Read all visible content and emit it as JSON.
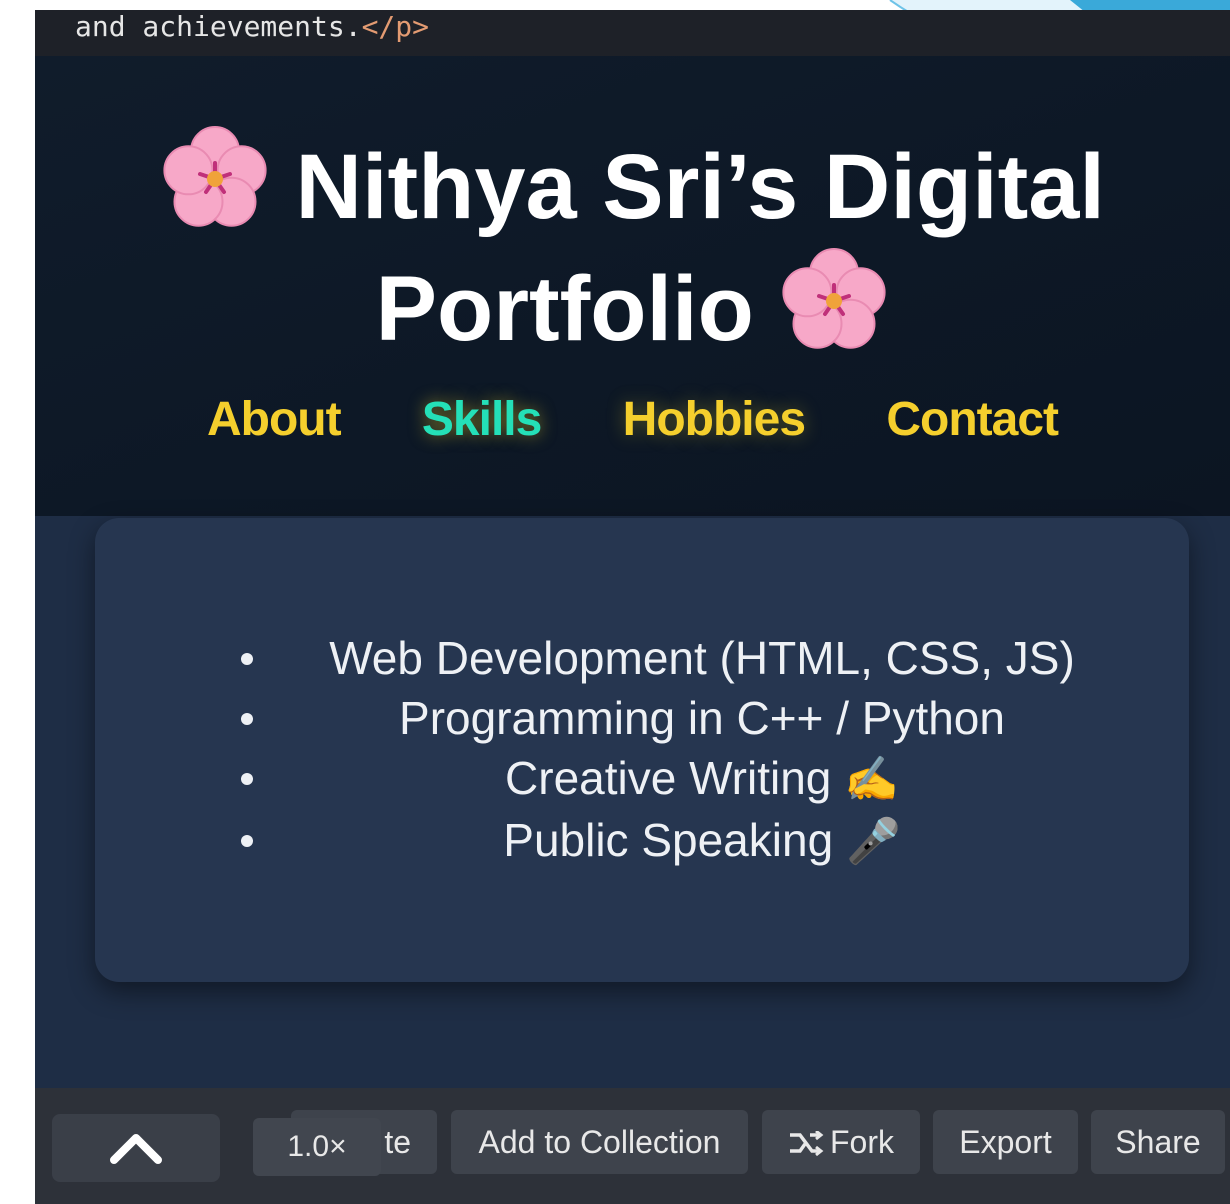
{
  "code_line": {
    "text": "and achievements.",
    "closing_tag": "</p>"
  },
  "page": {
    "title_line1": "Nithya Sri’s Digital",
    "title_line2": "Portfolio",
    "flower_icon": "cherry-blossom-icon",
    "nav": [
      {
        "label": "About",
        "active": false
      },
      {
        "label": "Skills",
        "active": true
      },
      {
        "label": "Hobbies",
        "active": false
      },
      {
        "label": "Contact",
        "active": false
      }
    ],
    "skills": [
      {
        "text": "Web Development (HTML, CSS, JS)",
        "emoji": ""
      },
      {
        "text": "Programming in C++ / Python",
        "emoji": ""
      },
      {
        "text": "Creative Writing",
        "emoji": "✍️"
      },
      {
        "text": "Public Speaking",
        "emoji": "🎤"
      }
    ]
  },
  "toolbar": {
    "up_icon": "chevron-up-icon",
    "speed": "1.0×",
    "partial_button": "te",
    "add_to_collection": "Add to Collection",
    "fork": "Fork",
    "fork_icon": "fork-icon",
    "export": "Export",
    "share": "Share"
  },
  "colors": {
    "nav_link": "#f5cf2d",
    "nav_active": "#24e0b8",
    "header_bg": "#0e1928",
    "card_bg": "#263650",
    "toolbar_bg": "#2d3139"
  }
}
